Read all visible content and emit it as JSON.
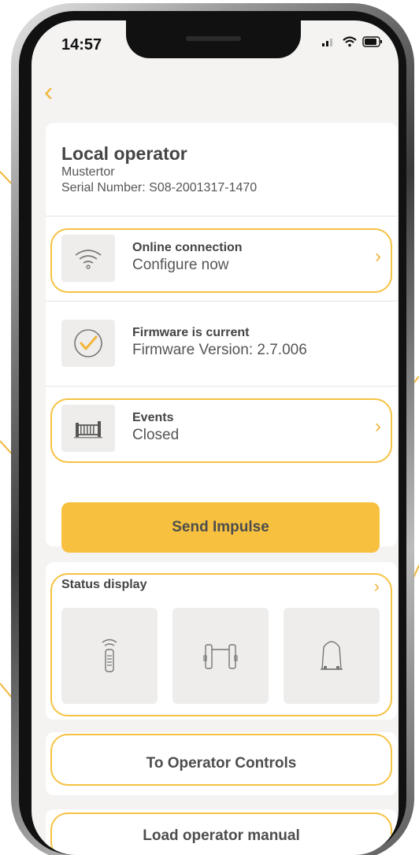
{
  "status_bar": {
    "time": "14:57"
  },
  "nav": {
    "back_icon": "chevron-left-icon"
  },
  "operator": {
    "title": "Local operator",
    "name": "Mustertor",
    "serial": "Serial Number: S08-2001317-1470"
  },
  "rows": {
    "online": {
      "title": "Online connection",
      "subtitle": "Configure now",
      "icon": "wifi-icon"
    },
    "firmware": {
      "title": "Firmware is current",
      "subtitle": "Firmware Version: 2.7.006",
      "icon": "checkmark-circle-icon"
    },
    "events": {
      "title": "Events",
      "subtitle": "Closed",
      "icon": "gate-icon"
    }
  },
  "actions": {
    "send_impulse": "Send Impulse",
    "operator_controls": "To Operator Controls",
    "load_manual": "Load operator manual"
  },
  "status_display": {
    "title": "Status display",
    "tiles": [
      "remote-control-icon",
      "photo-eye-icon",
      "warning-light-icon"
    ]
  },
  "colors": {
    "accent": "#f7c13f",
    "highlight": "#f5c242",
    "background": "#f4f3f2",
    "text": "#444444"
  }
}
